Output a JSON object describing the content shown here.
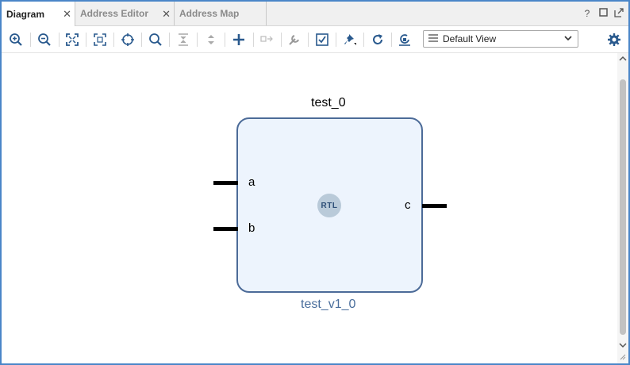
{
  "tabs": [
    {
      "label": "Diagram",
      "active": true
    },
    {
      "label": "Address Editor",
      "active": false
    },
    {
      "label": "Address Map",
      "active": false
    }
  ],
  "tab_close_glyph": "✕",
  "tab_bar_icons": [
    "help-icon",
    "maximize-icon",
    "float-icon"
  ],
  "toolbar": {
    "icons": [
      "zoom-in-icon",
      "zoom-out-icon",
      "fit-view-icon",
      "fit-selection-icon",
      "auto-fit-selection-icon",
      "search-icon",
      "collapse-icon",
      "expand-icon",
      "add-ip-icon",
      "make-external-icon",
      "properties-icon",
      "validate-icon",
      "pin-icon",
      "refresh-icon",
      "regenerate-layout-icon",
      "settings-icon"
    ],
    "view_select": "Default View"
  },
  "diagram": {
    "instance_name": "test_0",
    "module_name": "test_v1_0",
    "badge": "RTL",
    "input_ports": [
      "a",
      "b"
    ],
    "output_ports": [
      "c"
    ]
  },
  "colors": {
    "accent_border": "#4a86c8",
    "block_fill": "#edf4fd",
    "block_border": "#4c6b98",
    "module_name": "#4a6e9c"
  }
}
